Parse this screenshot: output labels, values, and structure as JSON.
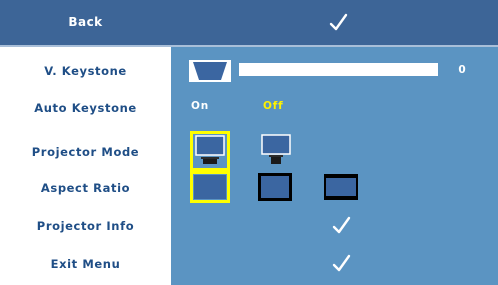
{
  "menu": {
    "back_label": "Back",
    "rows": {
      "v_keystone": {
        "label": "V. Keystone",
        "value": "0",
        "level": 0.0
      },
      "auto_keystone": {
        "label": "Auto Keystone",
        "on_label": "On",
        "off_label": "Off",
        "selected": "Off"
      },
      "projector_mode": {
        "label": "Projector Mode",
        "selected_index": 0,
        "options": [
          "front-projection-icon",
          "rear-projection-icon"
        ]
      },
      "aspect_ratio": {
        "label": "Aspect Ratio",
        "selected_index": 0,
        "options": [
          "native-ratio-icon",
          "4-3-ratio-icon",
          "16-9-ratio-icon"
        ]
      },
      "projector_info": {
        "label": "Projector Info"
      },
      "exit_menu": {
        "label": "Exit Menu"
      }
    }
  },
  "colors": {
    "header": "#3d6597",
    "panel": "#5b94c2",
    "label_text": "#1f4e86",
    "selection": "#ffff00",
    "off_text": "#fff200"
  }
}
